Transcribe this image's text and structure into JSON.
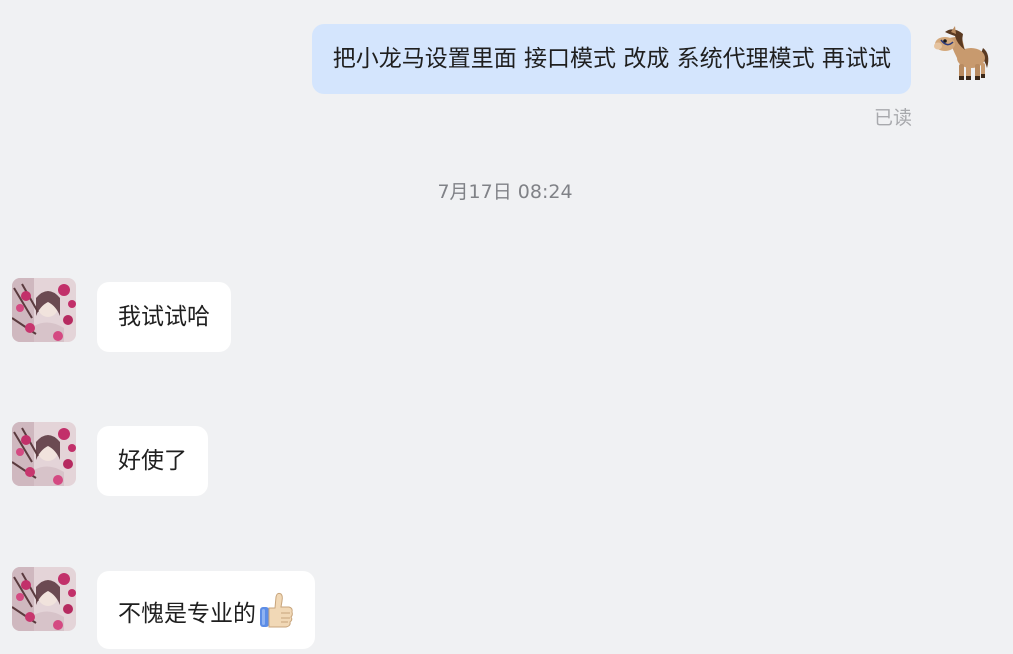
{
  "conversation": {
    "outgoing": {
      "text": "把小龙马设置里面 接口模式 改成  系统代理模式  再试试",
      "status": "已读"
    },
    "timestamp": "7月17日 08:24",
    "incoming": [
      {
        "text": "我试试哈"
      },
      {
        "text": "好使了"
      },
      {
        "text": "不愧是专业的",
        "emoji": "thumbs-up"
      }
    ]
  },
  "colors": {
    "background": "#f0f1f3",
    "outgoing_bubble": "#d4e5fd",
    "incoming_bubble": "#ffffff",
    "text": "#1f1f1f",
    "muted": "#808287"
  }
}
